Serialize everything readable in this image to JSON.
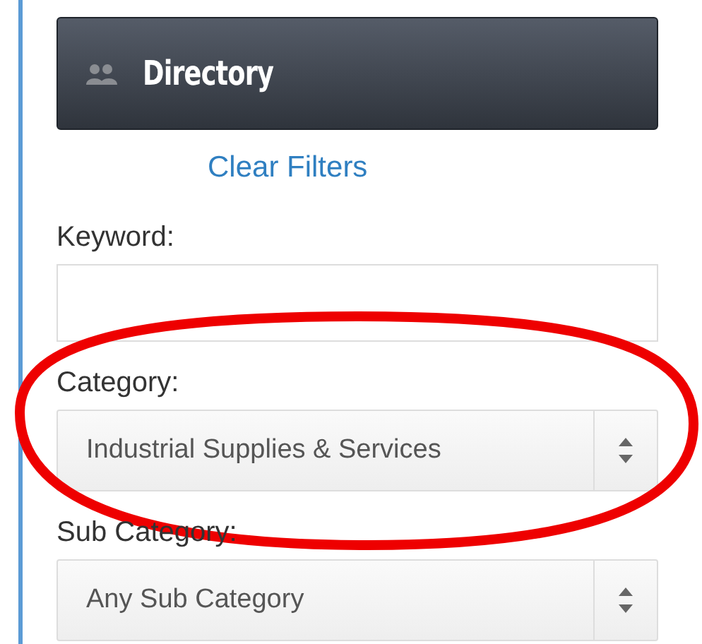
{
  "header": {
    "title": "Directory"
  },
  "clear_filters": {
    "label": "Clear Filters"
  },
  "fields": [
    {
      "kind": "text",
      "label": "Keyword:"
    },
    {
      "kind": "select",
      "label": "Category:",
      "value": "Industrial Supplies & Services"
    },
    {
      "kind": "select",
      "label": "Sub Category:",
      "value": "Any Sub Category"
    }
  ]
}
